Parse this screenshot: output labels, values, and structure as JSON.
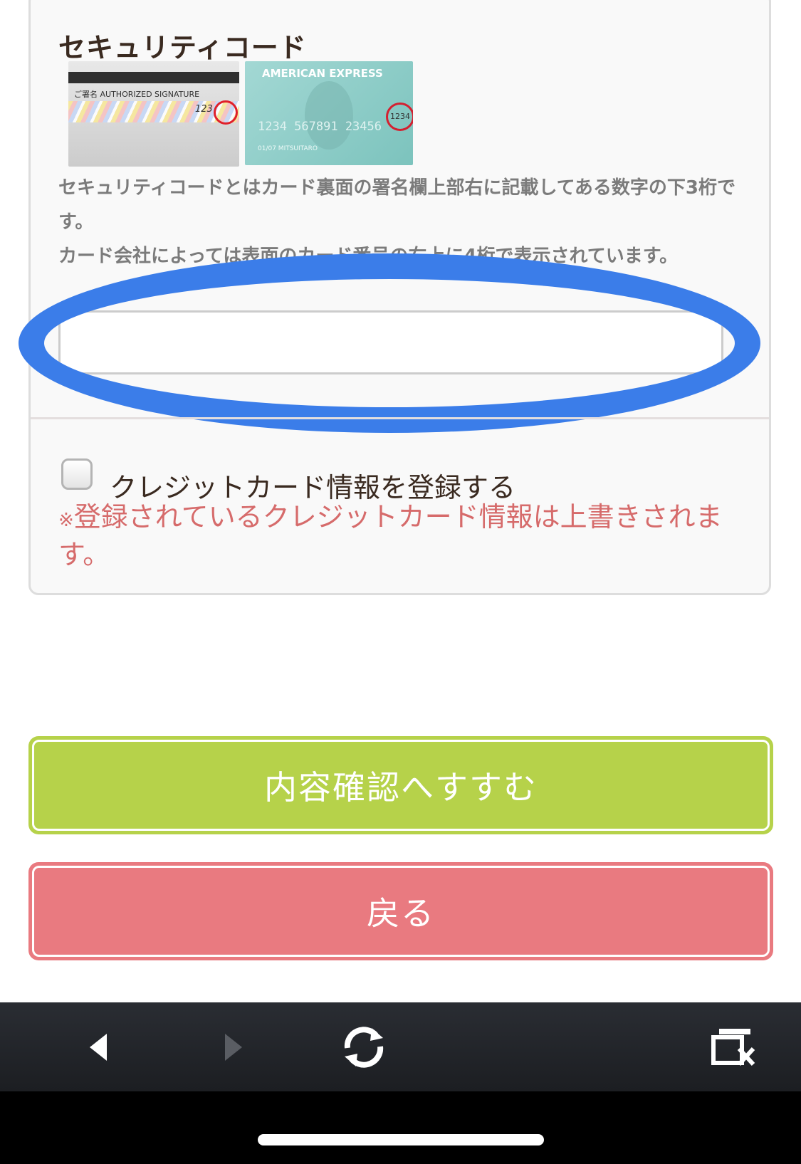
{
  "security": {
    "title": "セキュリティコード",
    "card_back": {
      "signature_label": "ご署名 AUTHORIZED SIGNATURE",
      "code": "123"
    },
    "amex_card": {
      "brand": "AMERICAN EXPRESS",
      "number": "1234 567891 23456",
      "holder": "01/07 MITSUITARO",
      "cid": "1234"
    },
    "description_1": "セキュリティコードとはカード裏面の署名欄上部右に記載してある数字の下3桁です。",
    "description_2": "カード会社によっては表面のカード番号の右上に4桁で表示されています。",
    "input_value": ""
  },
  "register": {
    "checkbox_label": "クレジットカード情報を登録する",
    "checked": false,
    "warning_mark": "※",
    "warning_text": "登録されているクレジットカード情報は上書きされます。"
  },
  "buttons": {
    "confirm_label": "内容確認へすすむ",
    "back_label": "戻る"
  },
  "browser_nav": {
    "icons": [
      "back-icon",
      "forward-icon",
      "reload-icon",
      "close-tabs-icon"
    ]
  },
  "colors": {
    "highlight": "#3b7de9",
    "confirm_button": "#b6d24a",
    "back_button": "#e97a80",
    "warning_text": "#d66b6b"
  }
}
